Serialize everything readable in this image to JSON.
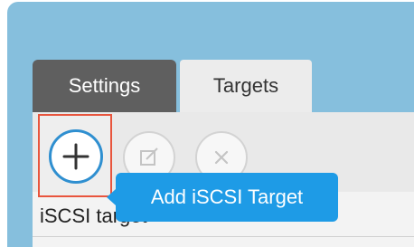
{
  "tabs": [
    {
      "label": "Settings",
      "active": true
    },
    {
      "label": "Targets",
      "active": false
    }
  ],
  "toolbar": {
    "add_icon": "plus-icon",
    "edit_icon": "edit-icon",
    "delete_icon": "close-icon",
    "add_tooltip": "Add iSCSI Target"
  },
  "section": {
    "label": "iSCSI target"
  },
  "colors": {
    "window_background": "#86bfdd",
    "active_tab": "#5f5f5f",
    "accent": "#1e9be6",
    "highlight_border": "#e8553d"
  }
}
